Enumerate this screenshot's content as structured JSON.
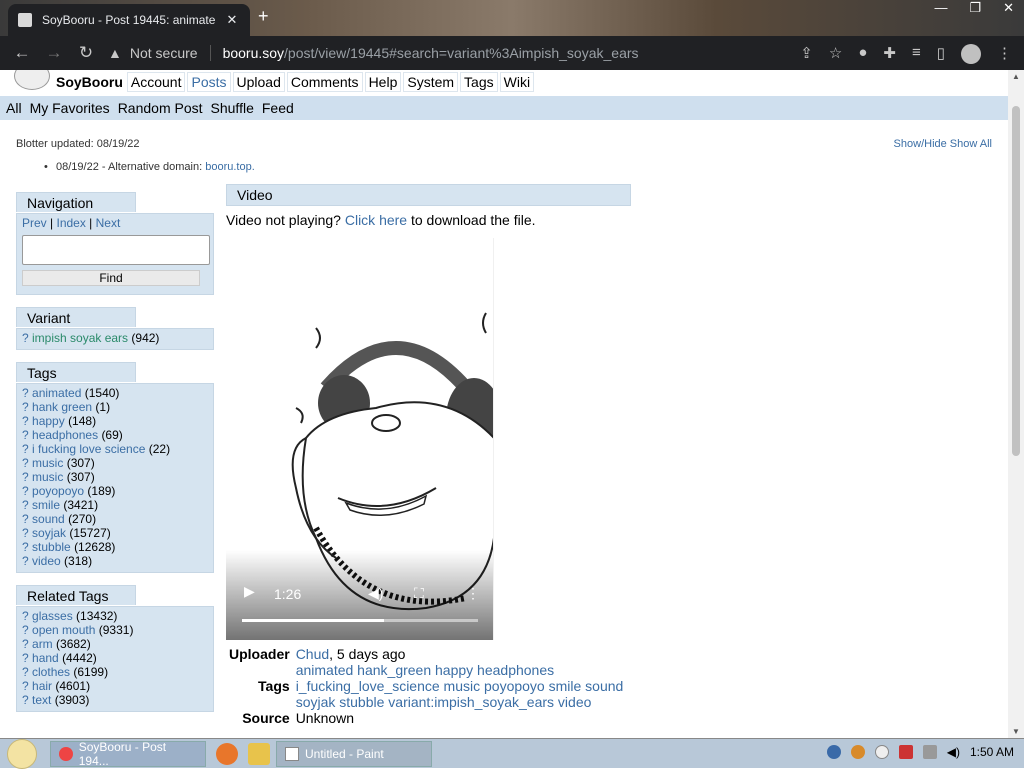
{
  "browser": {
    "tab_title": "SoyBooru - Post 19445: animate",
    "not_secure": "Not secure",
    "url_host": "booru.soy",
    "url_path": "/post/view/19445#search=variant%3Aimpish_soyak_ears"
  },
  "header": {
    "brand": "SoyBooru",
    "links": [
      "Account",
      "Posts",
      "Upload",
      "Comments",
      "Help",
      "System",
      "Tags",
      "Wiki"
    ]
  },
  "subnav": [
    "All",
    "My Favorites",
    "Random Post",
    "Shuffle",
    "Feed"
  ],
  "blotter": {
    "updated": "Blotter updated: 08/19/22",
    "controls": "Show/Hide Show All",
    "item_text": "08/19/22 - Alternative domain: ",
    "item_link": "booru.top."
  },
  "navigation": {
    "title": "Navigation",
    "prev": "Prev",
    "index": "Index",
    "next": "Next",
    "find": "Find"
  },
  "variant": {
    "title": "Variant",
    "items": [
      {
        "name": "impish soyak ears",
        "count": "(942)"
      }
    ]
  },
  "tags": {
    "title": "Tags",
    "items": [
      {
        "name": "animated",
        "count": "(1540)"
      },
      {
        "name": "hank green",
        "count": "(1)"
      },
      {
        "name": "happy",
        "count": "(148)"
      },
      {
        "name": "headphones",
        "count": "(69)"
      },
      {
        "name": "i fucking love science",
        "count": "(22)"
      },
      {
        "name": "music",
        "count": "(307)"
      },
      {
        "name": "music",
        "count": "(307)"
      },
      {
        "name": "poyopoyo",
        "count": "(189)"
      },
      {
        "name": "smile",
        "count": "(3421)"
      },
      {
        "name": "sound",
        "count": "(270)"
      },
      {
        "name": "soyjak",
        "count": "(15727)"
      },
      {
        "name": "stubble",
        "count": "(12628)"
      },
      {
        "name": "video",
        "count": "(318)"
      }
    ]
  },
  "related": {
    "title": "Related Tags",
    "items": [
      {
        "name": "glasses",
        "count": "(13432)"
      },
      {
        "name": "open mouth",
        "count": "(9331)"
      },
      {
        "name": "arm",
        "count": "(3682)"
      },
      {
        "name": "hand",
        "count": "(4442)"
      },
      {
        "name": "clothes",
        "count": "(6199)"
      },
      {
        "name": "hair",
        "count": "(4601)"
      },
      {
        "name": "text",
        "count": "(3903)"
      }
    ]
  },
  "video": {
    "title": "Video",
    "note_before": "Video not playing? ",
    "note_link": "Click here",
    "note_after": " to download the file.",
    "time": "1:26"
  },
  "info": {
    "uploader_label": "Uploader",
    "uploader_name": "Chud",
    "uploader_when": ", 5 days ago",
    "tags_label": "Tags",
    "tags_value": "animated hank_green happy headphones i_fucking_love_science music poyopoyo smile sound soyjak stubble variant:impish_soyak_ears video",
    "source_label": "Source",
    "source_value": "Unknown"
  },
  "taskbar": {
    "chrome_label": "SoyBooru - Post 194...",
    "paint_label": "Untitled - Paint",
    "clock": "1:50 AM"
  }
}
